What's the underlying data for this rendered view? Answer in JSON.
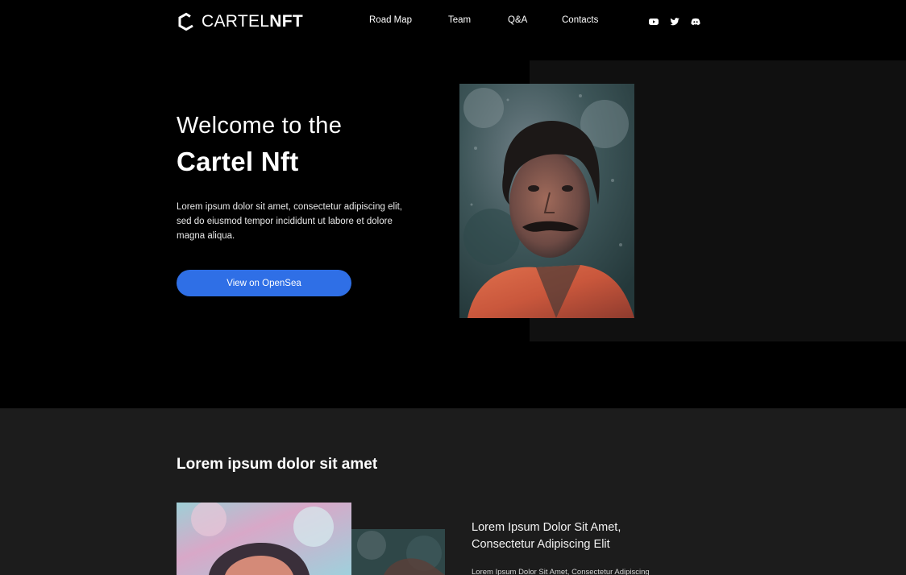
{
  "header": {
    "logo_light": "CARTEL",
    "logo_bold": "NFT",
    "nav": [
      {
        "label": "Road Map"
      },
      {
        "label": "Team"
      },
      {
        "label": "Q&A"
      },
      {
        "label": "Contacts"
      }
    ],
    "social": [
      {
        "icon": "youtube-icon"
      },
      {
        "icon": "twitter-icon"
      },
      {
        "icon": "discord-icon"
      }
    ]
  },
  "hero": {
    "title": "Welcome to the",
    "title_strong": "Cartel Nft",
    "text": "Lorem ipsum dolor sit amet, consectetur adipiscing elit, sed do eiusmod tempor incididunt ut labore et dolore magna aliqua.",
    "cta_label": "View on OpenSea"
  },
  "section2": {
    "title": "Lorem ipsum dolor sit amet",
    "feature_title": "Lorem Ipsum Dolor Sit Amet, Consectetur Adipiscing Elit",
    "feature_text": "Lorem Ipsum Dolor Sit Amet, Consectetur Adipiscing"
  },
  "colors": {
    "background": "#000000",
    "panel": "#101010",
    "section": "#1c1c1c",
    "accent": "#2f6fe6"
  }
}
